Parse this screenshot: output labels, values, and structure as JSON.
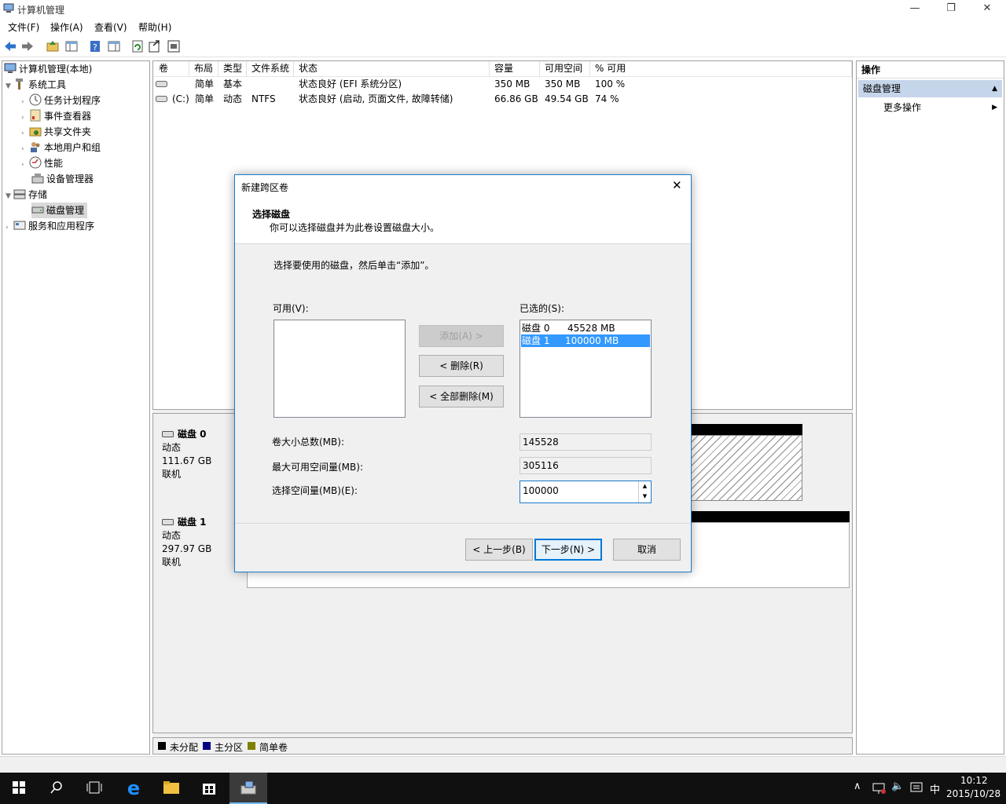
{
  "window": {
    "title": "计算机管理",
    "min_glyph": "—",
    "restore_glyph": "❐",
    "close_glyph": "✕"
  },
  "menu": [
    "文件(F)",
    "操作(A)",
    "查看(V)",
    "帮助(H)"
  ],
  "tree": {
    "root": "计算机管理(本地)",
    "system_tools": "系统工具",
    "task_scheduler": "任务计划程序",
    "event_viewer": "事件查看器",
    "shared_folders": "共享文件夹",
    "local_users": "本地用户和组",
    "performance": "性能",
    "device_manager": "设备管理器",
    "storage": "存储",
    "disk_management": "磁盘管理",
    "services_apps": "服务和应用程序"
  },
  "volume_table": {
    "columns": [
      "卷",
      "布局",
      "类型",
      "文件系统",
      "状态",
      "容量",
      "可用空间",
      "% 可用"
    ],
    "rows": [
      [
        "",
        "简单",
        "基本",
        "",
        "状态良好 (EFI 系统分区)",
        "350 MB",
        "350 MB",
        "100 %"
      ],
      [
        "(C:)",
        "简单",
        "动态",
        "NTFS",
        "状态良好 (启动, 页面文件, 故障转储)",
        "66.86 GB",
        "49.54 GB",
        "74 %"
      ]
    ]
  },
  "disks": [
    {
      "name": "磁盘 0",
      "type": "动态",
      "size": "111.67 GB",
      "status": "联机"
    },
    {
      "name": "磁盘 1",
      "type": "动态",
      "size": "297.97 GB",
      "status": "联机"
    }
  ],
  "legend": [
    {
      "label": "未分配",
      "color": "#000000"
    },
    {
      "label": "主分区",
      "color": "#000080"
    },
    {
      "label": "简单卷",
      "color": "#808000"
    }
  ],
  "actions": {
    "title": "操作",
    "section": "磁盘管理",
    "more": "更多操作"
  },
  "dialog": {
    "title": "新建跨区卷",
    "heading": "选择磁盘",
    "subheading": "你可以选择磁盘并为此卷设置磁盘大小。",
    "instruction": "选择要使用的磁盘，然后单击“添加”。",
    "available_label": "可用(V):",
    "selected_label": "已选的(S):",
    "add_button": "添加(A) >",
    "remove_button": "< 删除(R)",
    "remove_all_button": "< 全部删除(M)",
    "selected_disks": [
      {
        "disk": "磁盘 0",
        "size": "45528 MB"
      },
      {
        "disk": "磁盘 1",
        "size": "100000 MB"
      }
    ],
    "total_label": "卷大小总数(MB):",
    "total_value": "145528",
    "max_label": "最大可用空间量(MB):",
    "max_value": "305116",
    "amount_label": "选择空间量(MB)(E):",
    "amount_value": "100000",
    "back_button": "< 上一步(B)",
    "next_button": "下一步(N) >",
    "cancel_button": "取消"
  },
  "taskbar": {
    "time": "10:12",
    "date": "2015/10/28",
    "ime": "中"
  },
  "colors": {
    "accent": "#3399ff",
    "dialog_border": "#1979ca",
    "taskbar": "#101010"
  }
}
